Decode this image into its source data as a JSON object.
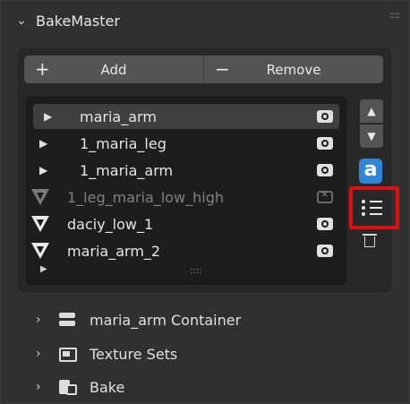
{
  "panel": {
    "title": "BakeMaster"
  },
  "toolbar": {
    "add_label": "Add",
    "remove_label": "Remove"
  },
  "list": {
    "items": [
      {
        "label": "maria_arm",
        "kind": "container",
        "enabled": true,
        "selected": true
      },
      {
        "label": "1_maria_leg",
        "kind": "container",
        "enabled": true,
        "selected": false
      },
      {
        "label": "1_maria_arm",
        "kind": "container",
        "enabled": true,
        "selected": false
      },
      {
        "label": "1_leg_maria_low_high",
        "kind": "mesh",
        "enabled": false,
        "selected": false
      },
      {
        "label": "daciy_low_1",
        "kind": "mesh",
        "enabled": true,
        "selected": false
      },
      {
        "label": "maria_arm_2",
        "kind": "mesh",
        "enabled": true,
        "selected": false
      }
    ]
  },
  "side_buttons": {
    "move_up": "▲",
    "move_down": "▼",
    "badge": "a"
  },
  "subpanels": [
    {
      "label": "maria_arm Container"
    },
    {
      "label": "Texture Sets"
    },
    {
      "label": "Bake"
    }
  ],
  "colors": {
    "badge": "#2f86d6",
    "highlight": "#e01010",
    "selection": "#3f3f3f"
  },
  "icons": [
    "chevron-down-icon",
    "plus-icon",
    "minus-icon",
    "expand-arrow-icon",
    "vertex-icon",
    "camera-icon",
    "camera-disabled-icon",
    "arrow-up-icon",
    "arrow-down-icon",
    "app-a-icon",
    "list-icon",
    "trash-icon",
    "container-icon",
    "texture-set-icon",
    "bake-icon"
  ]
}
